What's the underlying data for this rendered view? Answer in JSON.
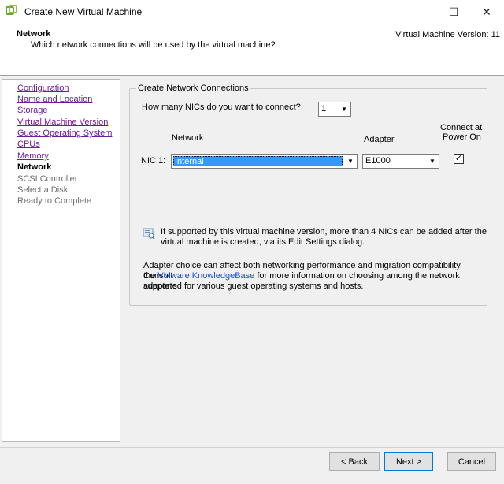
{
  "window": {
    "title": "Create New Virtual Machine",
    "icon": "vmware-logo-icon",
    "minimize_glyph": "—",
    "maximize_glyph": "☐",
    "close_glyph": "✕"
  },
  "header": {
    "step_title": "Network",
    "step_description": "Which network connections will be used by the virtual machine?",
    "vm_version": "Virtual Machine Version: 11"
  },
  "nav": {
    "items": [
      {
        "label": "Configuration",
        "state": "link"
      },
      {
        "label": "Name and Location",
        "state": "link"
      },
      {
        "label": "Storage",
        "state": "link"
      },
      {
        "label": "Virtual Machine Version",
        "state": "link"
      },
      {
        "label": "Guest Operating System",
        "state": "link"
      },
      {
        "label": "CPUs",
        "state": "link"
      },
      {
        "label": "Memory",
        "state": "link"
      },
      {
        "label": "Network",
        "state": "current"
      },
      {
        "label": "SCSI Controller",
        "state": "disabled"
      },
      {
        "label": "Select a Disk",
        "state": "disabled"
      },
      {
        "label": "Ready to Complete",
        "state": "disabled"
      }
    ]
  },
  "network": {
    "group_title": "Create Network Connections",
    "nic_count_question": "How many NICs do you want to connect?",
    "nic_count_value": "1",
    "col_network": "Network",
    "col_adapter": "Adapter",
    "col_connect_line1": "Connect at",
    "col_connect_line2": "Power On",
    "nic_label": "NIC 1:",
    "nic_network_value": "Internal",
    "nic_adapter_value": "E1000",
    "nic_connect_checked": "✓",
    "info_line1": "If supported by this virtual machine version, more than 4 NICs can be added after the",
    "info_line2": "virtual machine is created, via its Edit Settings dialog.",
    "adapter_note_line1": "Adapter choice can affect both networking performance and migration compatibility. Consult",
    "adapter_note_line2_prefix": "the ",
    "kb_link": "VMware KnowledgeBase",
    "adapter_note_line2_suffix": " for more information on choosing among the network adapters",
    "adapter_note_line3": "supported for various guest operating systems and hosts."
  },
  "footer": {
    "back_label": "< Back",
    "next_label": "Next >",
    "cancel_label": "Cancel"
  },
  "colors": {
    "nav_link": "#6b1d9c",
    "kb_link": "#1a4fd1",
    "selection": "#3399ff",
    "dialog_bg": "#f0f0f0"
  }
}
